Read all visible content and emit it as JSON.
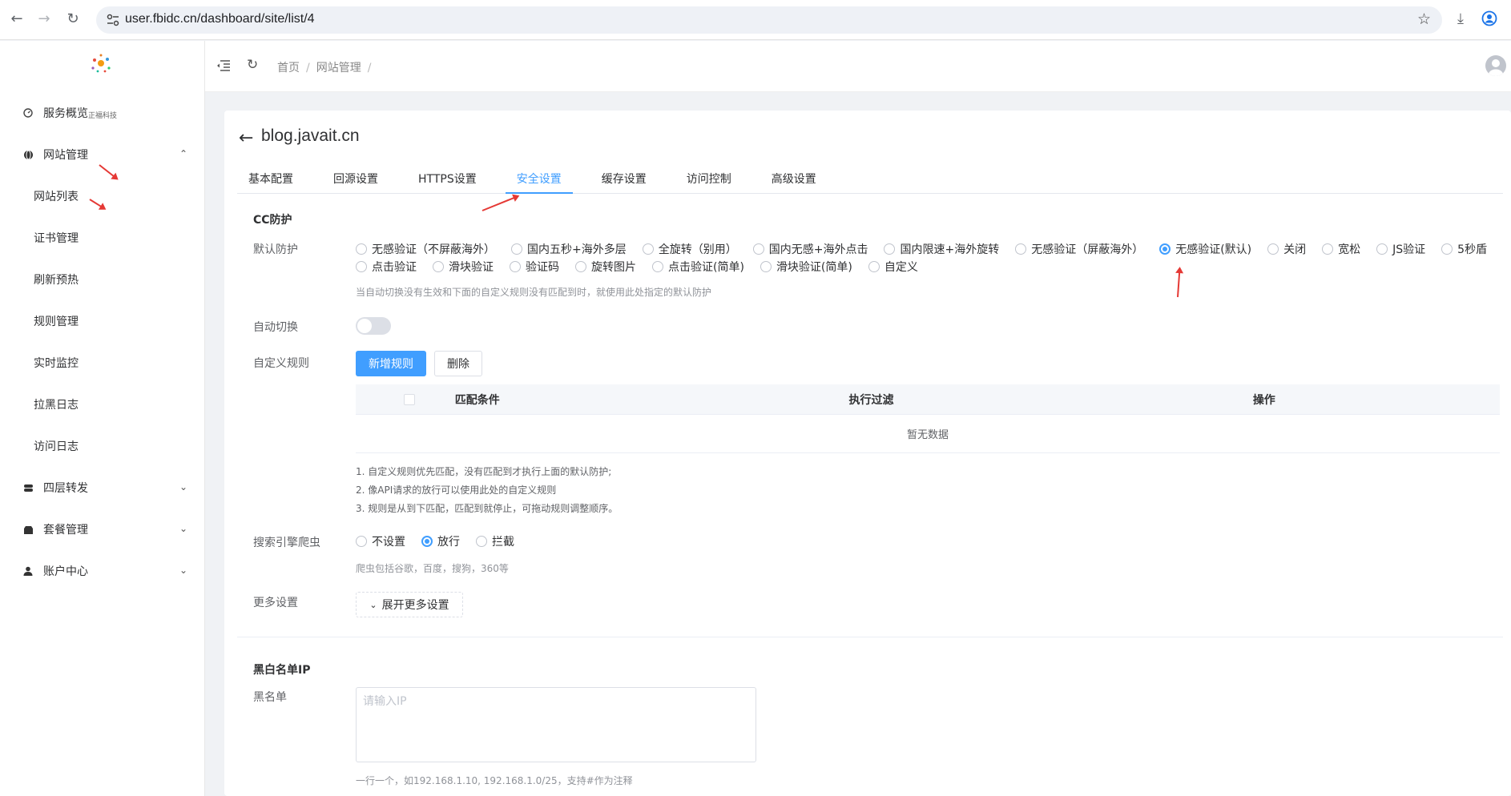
{
  "browser": {
    "url": "user.fbidc.cn/dashboard/site/list/4"
  },
  "sidebar": {
    "logo_text": "正福科技",
    "items": [
      {
        "label": "服务概览",
        "icon": "dashboard-icon"
      },
      {
        "label": "网站管理",
        "icon": "globe-icon",
        "expanded": true
      },
      {
        "label": "网站列表"
      },
      {
        "label": "证书管理"
      },
      {
        "label": "刷新预热"
      },
      {
        "label": "规则管理"
      },
      {
        "label": "实时监控"
      },
      {
        "label": "拉黑日志"
      },
      {
        "label": "访问日志"
      },
      {
        "label": "四层转发",
        "icon": "forward-icon"
      },
      {
        "label": "套餐管理",
        "icon": "package-icon"
      },
      {
        "label": "账户中心",
        "icon": "user-icon"
      }
    ]
  },
  "breadcrumb": {
    "home": "首页",
    "section": "网站管理"
  },
  "page": {
    "site_title": "blog.javait.cn",
    "tabs": [
      "基本配置",
      "回源设置",
      "HTTPS设置",
      "安全设置",
      "缓存设置",
      "访问控制",
      "高级设置"
    ],
    "active_tab": "安全设置"
  },
  "cc": {
    "section_title": "CC防护",
    "default_label": "默认防护",
    "options": [
      "无感验证（不屏蔽海外）",
      "国内五秒+海外多层",
      "全旋转（别用）",
      "国内无感+海外点击",
      "国内限速+海外旋转",
      "无感验证（屏蔽海外）",
      "无感验证(默认)",
      "关闭",
      "宽松",
      "JS验证",
      "5秒盾",
      "点击验证",
      "滑块验证",
      "验证码",
      "旋转图片",
      "点击验证(简单)",
      "滑块验证(简单)",
      "自定义"
    ],
    "selected": "无感验证(默认)",
    "default_hint": "当自动切换没有生效和下面的自定义规则没有匹配到时，就使用此处指定的默认防护",
    "auto_switch_label": "自动切换",
    "auto_switch_on": false,
    "custom_label": "自定义规则",
    "add_button": "新增规则",
    "delete_button": "删除",
    "table_headers": [
      "匹配条件",
      "执行过滤",
      "操作"
    ],
    "empty_text": "暂无数据",
    "notes": [
      "1. 自定义规则优先匹配，没有匹配到才执行上面的默认防护;",
      "2. 像API请求的放行可以使用此处的自定义规则",
      "3. 规则是从到下匹配，匹配到就停止，可拖动规则调整顺序。"
    ],
    "crawler_label": "搜索引擎爬虫",
    "crawler_options": [
      "不设置",
      "放行",
      "拦截"
    ],
    "crawler_selected": "放行",
    "crawler_hint": "爬虫包括谷歌，百度，搜狗，360等",
    "more_label": "更多设置",
    "expand_button": "展开更多设置"
  },
  "blacklist": {
    "section_title": "黑白名单IP",
    "label": "黑名单",
    "placeholder": "请输入IP",
    "hint": "一行一个，如192.168.1.10, 192.168.1.0/25，支持#作为注释"
  },
  "colors": {
    "accent": "#409eff",
    "annotation": "#e53935"
  }
}
